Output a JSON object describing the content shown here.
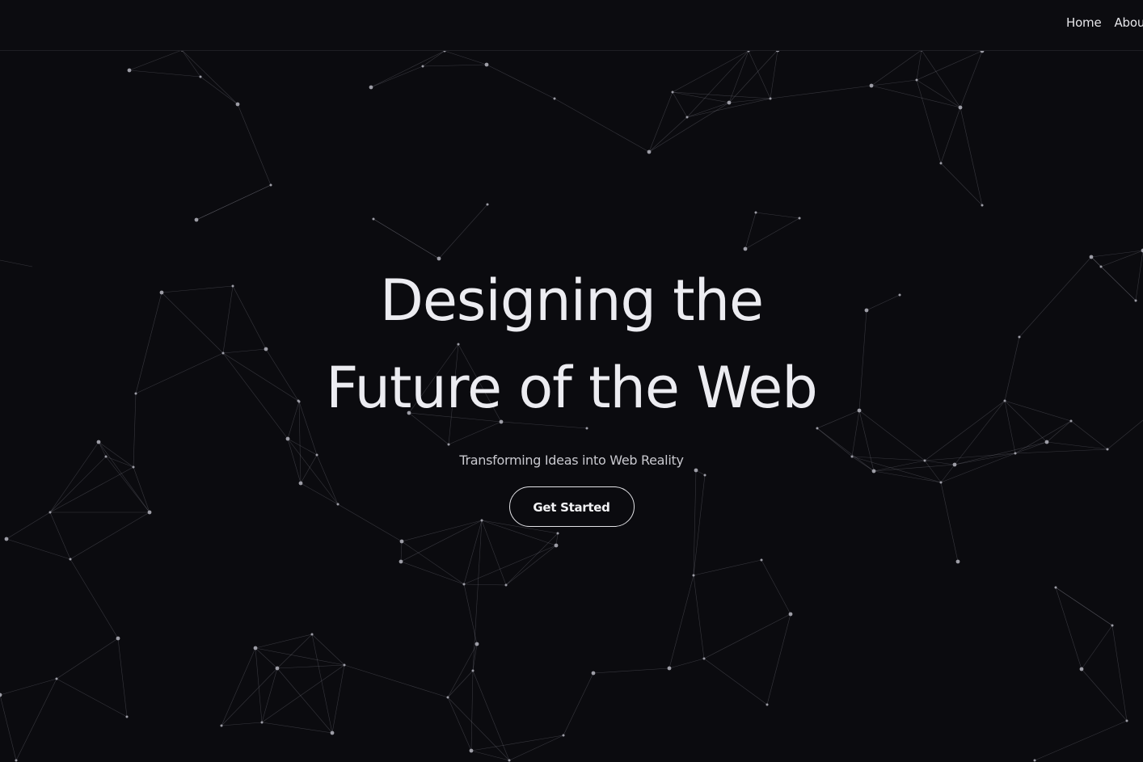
{
  "nav": {
    "items": [
      {
        "label": "Home"
      },
      {
        "label": "About"
      }
    ]
  },
  "hero": {
    "title_line1": "Designing the",
    "title_line2": "Future of the Web",
    "subtitle": "Transforming Ideas into Web Reality",
    "cta_label": "Get Started"
  },
  "background": {
    "icon": "particle-network",
    "colors": {
      "page": "#0b0b0f",
      "line": "#8a8a94",
      "node": "#9d9da6"
    }
  }
}
